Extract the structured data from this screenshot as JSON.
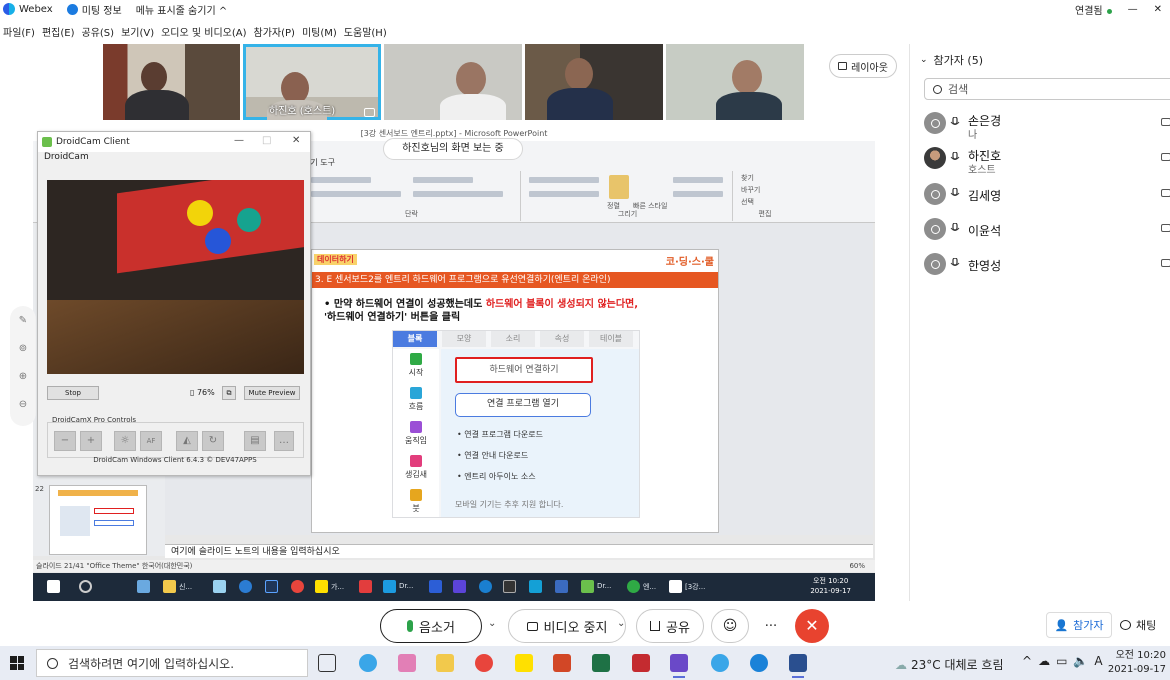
{
  "titlebar": {
    "app_name": "Webex",
    "meeting_info": "미팅 정보",
    "hide_menu": "메뉴 표시줄 숨기기 ^",
    "connection_status": "연결됨",
    "minimize": "—",
    "close": "✕"
  },
  "menubar": {
    "items": [
      "파일(F)",
      "편집(E)",
      "공유(S)",
      "보기(V)",
      "오디오 및 비디오(A)",
      "참가자(P)",
      "미팅(M)",
      "도움말(H)"
    ]
  },
  "thumbnails": {
    "active_name": "하진호 (호스트)"
  },
  "layout_button": "레이아웃",
  "share": {
    "ppt_title": "[3강 센서보드 엔트리.pptx] - Microsoft PowerPoint",
    "viewing_badge": "하진호님의 화면 보는 중",
    "ribbon_tab": "개기 도구",
    "ribbon_groups": [
      "단락",
      "그리기",
      "편집"
    ],
    "ribbon_find": "찾기",
    "ribbon_replace": "바꾸기",
    "ribbon_select": "선택",
    "ribbon_arrange": "정렬",
    "ribbon_quick": "빠른 스타일",
    "slide": {
      "tag": "데이터하기",
      "brand": "코·딩·스·쿨",
      "banner": "3. E 센서보드2를 엔트리 하드웨어 프로그램으로 유선연결하기(엔트리 온라인)",
      "line1_prefix": "• 만약 하드웨어 연결이 성공했는데도 ",
      "line1_highlight": "하드웨어 블록이 생성되지 않는다면,",
      "line2": "'하드웨어 연결하기' 버튼을 클릭",
      "tabs": [
        "블록",
        "모양",
        "소리",
        "속성",
        "테이블"
      ],
      "categories": [
        "시작",
        "흐름",
        "움직임",
        "생김새",
        "붓"
      ],
      "hw_button": "하드웨어 연결하기",
      "prog_button": "연결 프로그램 열기",
      "list": [
        "• 연결 프로그램 다운로드",
        "• 연결 안내 다운로드",
        "• 엔트리 아두이노 소스"
      ],
      "footer": "모바일 기기는 추후 지원 합니다."
    },
    "slide_number_label": "22",
    "notes": "여기에 슬라이드 노트의 내용을 입력하십시오",
    "status_left": "슬라이드 21/41   \"Office Theme\"   한국어(대한민국)",
    "status_zoom": "60%",
    "taskbar_labels": [
      "신...",
      "가...",
      "Dr...",
      "엔...",
      "[3강..."
    ],
    "taskbar_time": "오전 10:20",
    "taskbar_date": "2021-09-17"
  },
  "droidcam": {
    "title": "DroidCam Client",
    "menu": "DroidCam",
    "stop": "Stop",
    "percent": "76%",
    "mute_preview": "Mute Preview",
    "pro_controls": "DroidCamX Pro Controls",
    "footer": "DroidCam Windows Client 6.4.3 © DEV47APPS"
  },
  "participants": {
    "header": "참가자 (5)",
    "search_placeholder": "검색",
    "list": [
      {
        "name": "손은경",
        "sub": "나"
      },
      {
        "name": "하진호",
        "sub": "호스트"
      },
      {
        "name": "김세영",
        "sub": ""
      },
      {
        "name": "이윤석",
        "sub": ""
      },
      {
        "name": "한영성",
        "sub": ""
      }
    ]
  },
  "controls": {
    "mute": "음소거",
    "stop_video": "비디오 중지",
    "share": "공유",
    "more": "···",
    "leave": "✕",
    "participants_tab": "참가자",
    "chat_tab": "채팅"
  },
  "taskbar": {
    "search_placeholder": "검색하려면 여기에 입력하십시오.",
    "weather": "23°C 대체로 흐림",
    "lang": "A",
    "time": "오전 10:20",
    "date": "2021-09-17"
  },
  "colors": {
    "accent_blue": "#35b3e8",
    "leave_red": "#e8432f",
    "banner_orange": "#e65722",
    "hw_button_red": "#e02020"
  }
}
